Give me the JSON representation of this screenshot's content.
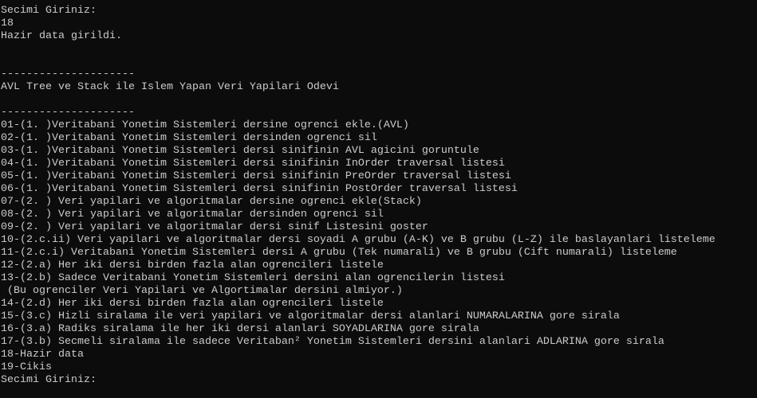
{
  "console": {
    "lines": [
      "19-Cikis",
      "Secimi Giriniz:",
      "18",
      "Hazir data girildi.",
      "",
      "",
      "---------------------",
      "AVL Tree ve Stack ile Islem Yapan Veri Yapilari Odevi",
      "",
      "---------------------",
      "01-(1. )Veritabani Yonetim Sistemleri dersine ogrenci ekle.(AVL)",
      "02-(1. )Veritabani Yonetim Sistemleri dersinden ogrenci sil",
      "03-(1. )Veritabani Yonetim Sistemleri dersi sinifinin AVL agicini goruntule",
      "04-(1. )Veritabani Yonetim Sistemleri dersi sinifinin InOrder traversal listesi",
      "05-(1. )Veritabani Yonetim Sistemleri dersi sinifinin PreOrder traversal listesi",
      "06-(1. )Veritabani Yonetim Sistemleri dersi sinifinin PostOrder traversal listesi",
      "07-(2. ) Veri yapilari ve algoritmalar dersine ogrenci ekle(Stack)",
      "08-(2. ) Veri yapilari ve algoritmalar dersinden ogrenci sil",
      "09-(2. ) Veri yapilari ve algoritmalar dersi sinif Listesini goster",
      "10-(2.c.ii) Veri yapilari ve algoritmalar dersi soyadi A grubu (A-K) ve B grubu (L-Z) ile baslayanlari listeleme",
      "11-(2.c.i) Veritabani Yonetim Sistemleri dersi A grubu (Tek numarali) ve B grubu (Cift numarali) listeleme",
      "12-(2.a) Her iki dersi birden fazla alan ogrencileri listele",
      "13-(2.b) Sadece Veritabani Yonetim Sistemleri dersini alan ogrencilerin listesi",
      " (Bu ogrenciler Veri Yapilari ve Algortimalar dersini almiyor.)",
      "14-(2.d) Her iki dersi birden fazla alan ogrencileri listele",
      "15-(3.c) Hizli siralama ile veri yapilari ve algoritmalar dersi alanlari NUMARALARINA gore sirala",
      "16-(3.a) Radiks siralama ile her iki dersi alanlari SOYADLARINA gore sirala",
      "17-(3.b) Secmeli siralama ile sadece Veritaban² Yonetim Sistemleri dersini alanlari ADLARINA gore sirala",
      "18-Hazir data",
      "19-Cikis",
      "Secimi Giriniz:"
    ]
  },
  "colors": {
    "background": "#0c0c0c",
    "text": "#cccccc"
  }
}
